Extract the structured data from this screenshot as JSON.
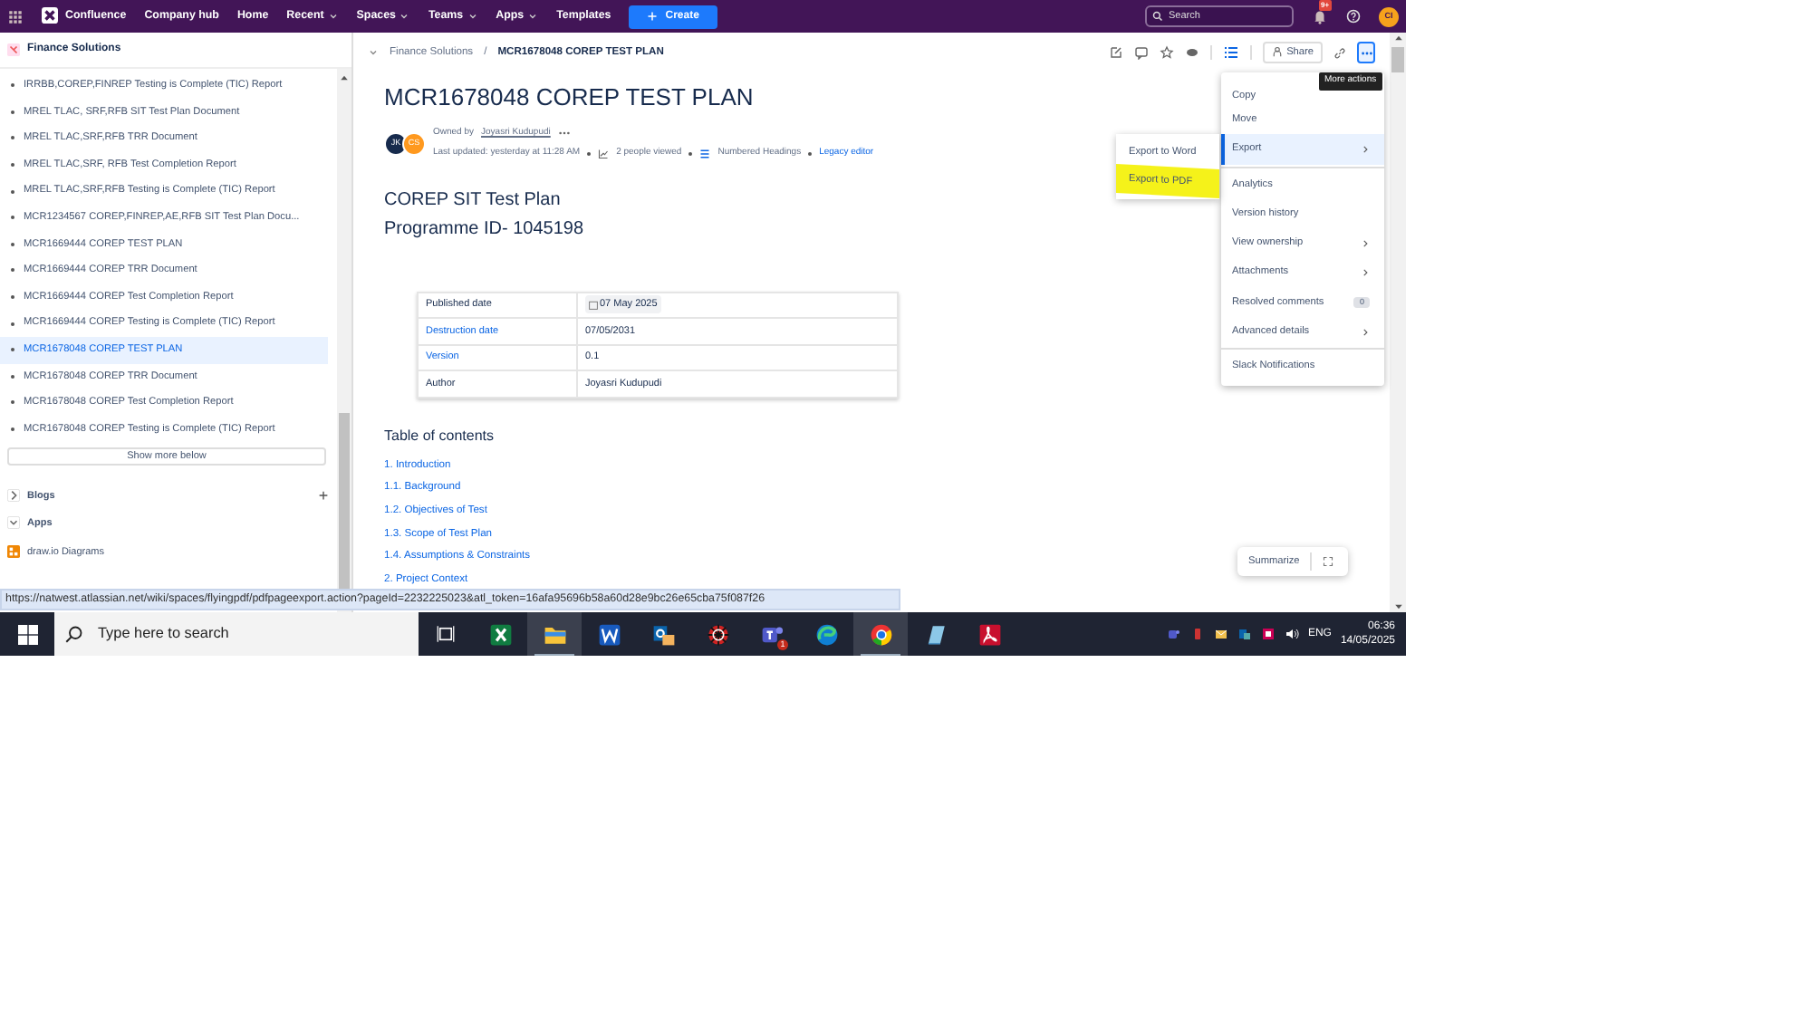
{
  "topnav": {
    "logo": "Confluence",
    "items": [
      {
        "label": "Company hub",
        "dropdown": false
      },
      {
        "label": "Home",
        "dropdown": false
      },
      {
        "label": "Recent",
        "dropdown": true
      },
      {
        "label": "Spaces",
        "dropdown": true
      },
      {
        "label": "Teams",
        "dropdown": true
      },
      {
        "label": "Apps",
        "dropdown": true
      },
      {
        "label": "Templates",
        "dropdown": false
      }
    ],
    "create": "Create",
    "search": {
      "placeholder": "Search"
    },
    "notification_badge": "9+",
    "avatar": "CI"
  },
  "sidebar": {
    "space": "Finance Solutions",
    "pages": [
      {
        "label": "IRRBB,COREP,FINREP Testing is Complete (TIC) Report",
        "selected": false
      },
      {
        "label": "MREL TLAC, SRF,RFB SIT Test Plan Document",
        "selected": false
      },
      {
        "label": "MREL TLAC,SRF,RFB TRR Document",
        "selected": false
      },
      {
        "label": "MREL TLAC,SRF, RFB Test Completion Report",
        "selected": false
      },
      {
        "label": "MREL TLAC,SRF,RFB Testing is Complete (TIC) Report",
        "selected": false
      },
      {
        "label": "MCR1234567 COREP,FINREP,AE,RFB SIT Test Plan Docu...",
        "selected": false
      },
      {
        "label": "MCR1669444 COREP TEST PLAN",
        "selected": false
      },
      {
        "label": "MCR1669444 COREP TRR Document",
        "selected": false
      },
      {
        "label": "MCR1669444 COREP Test Completion Report",
        "selected": false
      },
      {
        "label": "MCR1669444 COREP Testing is Complete (TIC) Report",
        "selected": false
      },
      {
        "label": "MCR1678048 COREP TEST PLAN",
        "selected": true
      },
      {
        "label": "MCR1678048 COREP TRR Document",
        "selected": false
      },
      {
        "label": "MCR1678048 COREP Test Completion Report",
        "selected": false
      },
      {
        "label": "MCR1678048 COREP Testing is Complete (TIC) Report",
        "selected": false
      }
    ],
    "show_more": "Show more below",
    "sections": [
      {
        "label": "Blogs",
        "expanded": false,
        "addable": true
      },
      {
        "label": "Apps",
        "expanded": true,
        "addable": false
      }
    ],
    "apps": [
      "draw.io Diagrams"
    ]
  },
  "breadcrumb": {
    "separator": "/",
    "items": [
      "Finance Solutions",
      "MCR1678048 COREP TEST PLAN"
    ]
  },
  "toolbar": {
    "share": "Share",
    "tooltip": "More actions"
  },
  "page": {
    "title": "MCR1678048 COREP TEST PLAN",
    "avatars": [
      {
        "initials": "JK",
        "color": "#172b4d"
      },
      {
        "initials": "CS",
        "color": "#ff991f"
      }
    ],
    "owned_by": "Owned by",
    "owner": "Joyasri Kudupudi",
    "last_updated": "Last updated: yesterday at 11:28 AM",
    "viewed": "2 people viewed",
    "numbered": "Numbered Headings",
    "legacy": "Legacy editor",
    "headings": [
      "COREP SIT Test Plan",
      "Programme ID- 1045198"
    ],
    "table": [
      {
        "label": "Published date",
        "link": false,
        "value": "07 May 2025",
        "kind": "date"
      },
      {
        "label": "Destruction date",
        "link": true,
        "value": "07/05/2031",
        "kind": "text"
      },
      {
        "label": "Version",
        "link": true,
        "value": "0.1",
        "kind": "text"
      },
      {
        "label": "Author",
        "link": false,
        "value": "Joyasri Kudupudi",
        "kind": "text"
      }
    ],
    "toc_title": "Table of contents",
    "toc": [
      "1. Introduction",
      "1.1. Background",
      "1.2. Objectives of Test",
      "1.3. Scope of Test Plan",
      "1.4. Assumptions & Constraints",
      "2. Project Context"
    ]
  },
  "menu": {
    "groups": [
      [
        {
          "label": "Copy",
          "submenu": false,
          "selected": false
        },
        {
          "label": "Move",
          "submenu": false,
          "selected": false
        },
        {
          "label": "Export",
          "submenu": true,
          "selected": true
        }
      ],
      [
        {
          "label": "Analytics",
          "submenu": false,
          "selected": false
        },
        {
          "label": "Version history",
          "submenu": false,
          "selected": false
        },
        {
          "label": "View ownership",
          "submenu": true,
          "selected": false
        },
        {
          "label": "Attachments",
          "submenu": true,
          "selected": false
        },
        {
          "label": "Resolved comments",
          "submenu": false,
          "selected": false,
          "badge": "0"
        },
        {
          "label": "Advanced details",
          "submenu": true,
          "selected": false
        }
      ],
      [
        {
          "label": "Slack Notifications",
          "submenu": false,
          "selected": false
        }
      ]
    ],
    "submenu": [
      {
        "label": "Export to Word",
        "highlighted": false
      },
      {
        "label": "Export to PDF",
        "highlighted": true
      }
    ]
  },
  "summarize": "Summarize",
  "status_url": "https://natwest.atlassian.net/wiki/spaces/flyingpdf/pdfpageexport.action?pageId=2232225023&atl_token=16afa95696b58a60d28e9bc26e65cba75f087f26",
  "taskbar": {
    "search": {
      "placeholder": "Type here to search"
    },
    "apps": [
      {
        "kind": "spreadsheet",
        "active": false
      },
      {
        "kind": "folder",
        "active": true
      },
      {
        "kind": "document",
        "active": false
      },
      {
        "kind": "mail",
        "active": false
      },
      {
        "kind": "web",
        "active": false
      },
      {
        "kind": "chat",
        "active": false,
        "badge": "1"
      },
      {
        "kind": "edge",
        "active": false
      },
      {
        "kind": "chrome",
        "active": true
      },
      {
        "kind": "notes",
        "active": false
      },
      {
        "kind": "pdf",
        "active": false
      }
    ],
    "language": "ENG",
    "time": "06:36",
    "date": "14/05/2025"
  }
}
